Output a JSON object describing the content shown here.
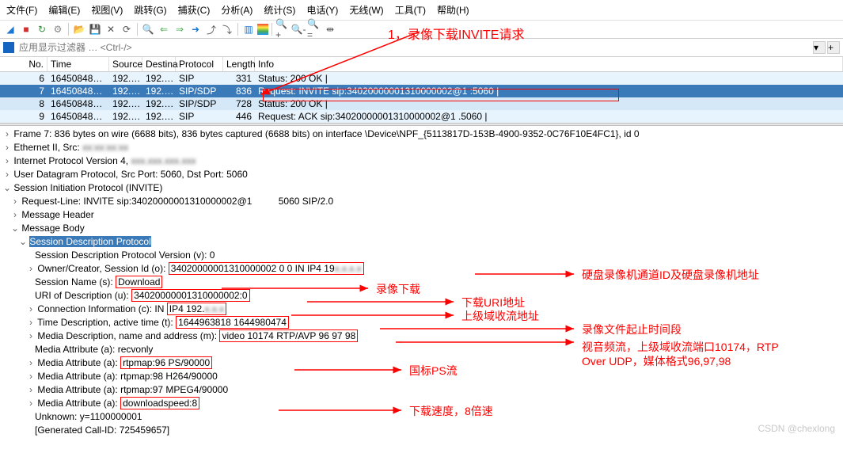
{
  "menu": {
    "items": [
      "文件(F)",
      "编辑(E)",
      "视图(V)",
      "跳转(G)",
      "捕获(C)",
      "分析(A)",
      "统计(S)",
      "电话(Y)",
      "无线(W)",
      "工具(T)",
      "帮助(H)"
    ]
  },
  "filter": {
    "placeholder": "应用显示过滤器 … <Ctrl-/>"
  },
  "packets": {
    "headers": [
      "No.",
      "Time",
      "Source",
      "Destina",
      "Protocol",
      "Length",
      "Info"
    ],
    "rows": [
      {
        "no": "6",
        "time": "16450848…",
        "src": "192.…",
        "dst": "192.…",
        "proto": "SIP",
        "len": "331",
        "info": "Status: 200 OK  |",
        "cls": "even"
      },
      {
        "no": "7",
        "time": "16450848…",
        "src": "192.…",
        "dst": "192.…",
        "proto": "SIP/SDP",
        "len": "836",
        "info": "Request: INVITE sip:34020000001310000002@1           :5060  |",
        "cls": "sel"
      },
      {
        "no": "8",
        "time": "16450848…",
        "src": "192.…",
        "dst": "192.…",
        "proto": "SIP/SDP",
        "len": "728",
        "info": "Status: 200 OK  |",
        "cls": "odd"
      },
      {
        "no": "9",
        "time": "16450848…",
        "src": "192.…",
        "dst": "192.…",
        "proto": "SIP",
        "len": "446",
        "info": "Request: ACK sip:34020000001310000002@1            .5060  |",
        "cls": "even"
      }
    ]
  },
  "details": {
    "frame": "Frame 7: 836 bytes on wire (6688 bits), 836 bytes captured (6688 bits) on interface \\Device\\NPF_{5113817D-153B-4900-9352-0C76F10E4FC1}, id 0",
    "eth": "Ethernet II, Src:",
    "ip": "Internet Protocol Version 4,",
    "udp": "User Datagram Protocol, Src Port: 5060, Dst Port: 5060",
    "sip": "Session Initiation Protocol (INVITE)",
    "reqline": "Request-Line: INVITE sip:34020000001310000002@1          5060 SIP/2.0",
    "msghdr": "Message Header",
    "msgbody": "Message Body",
    "sdp": "Session Description Protocol",
    "v": "Session Description Protocol Version (v): 0",
    "o_lbl": "Owner/Creator, Session Id (o):",
    "o_val": "34020000001310000002 0 0 IN IP4 19",
    "s_lbl": "Session Name (s):",
    "s_val": "Download",
    "u_lbl": "URI of Description (u):",
    "u_val": "34020000001310000002:0",
    "c_lbl": "Connection Information (c): IN",
    "c_val": "IP4 192.",
    "t_lbl": "Time Description, active time (t):",
    "t_val": "1644963818 1644980474",
    "m_lbl": "Media Description, name and address (m):",
    "m_val": "video 10174 RTP/AVP 96 97 98",
    "a1": "Media Attribute (a): recvonly",
    "a2_lbl": "Media Attribute (a):",
    "a2_val": "rtpmap:96 PS/90000",
    "a3": "Media Attribute (a): rtpmap:98 H264/90000",
    "a4": "Media Attribute (a): rtpmap:97 MPEG4/90000",
    "a5_lbl": "Media Attribute (a):",
    "a5_val": "downloadspeed:8",
    "unk": "Unknown: y=1100000001",
    "cid": "[Generated Call-ID: 725459657]"
  },
  "anno": {
    "title": "1，录像下载INVITE请求",
    "o": "硬盘录像机通道ID及硬盘录像机地址",
    "s": "录像下载",
    "u": "下载URI地址",
    "c": "上级域收流地址",
    "t": "录像文件起止时间段",
    "m1": "视音频流，上级域收流端口10174，RTP",
    "m2": "Over UDP，媒体格式96,97,98",
    "ps": "国标PS流",
    "spd": "下载速度，8倍速",
    "wm": "CSDN @chexlong"
  }
}
